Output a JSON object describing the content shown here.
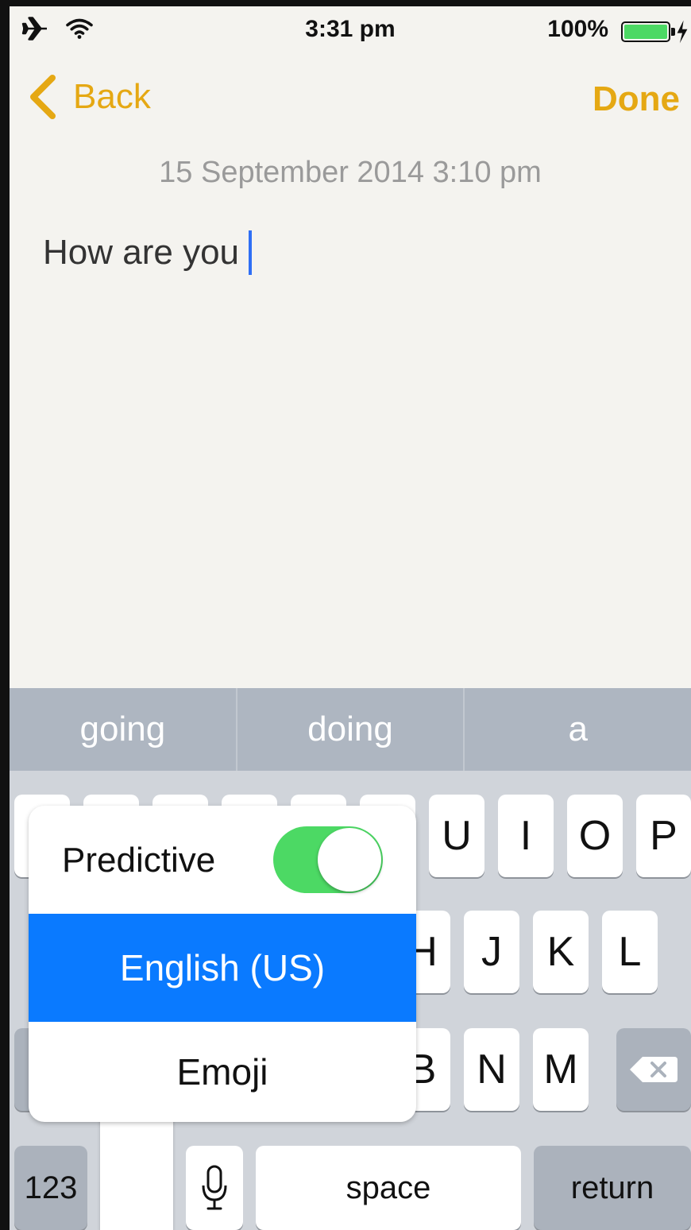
{
  "status_bar": {
    "time": "3:31 pm",
    "battery_percent": "100%",
    "battery_level": 1.0,
    "icons": [
      "airplane-icon",
      "wifi-icon",
      "battery-icon",
      "charging-bolt-icon"
    ]
  },
  "nav": {
    "back_label": "Back",
    "done_label": "Done",
    "accent_color": "#e5a813"
  },
  "note": {
    "date": "15 September 2014 3:10 pm",
    "text": "How are you"
  },
  "keyboard": {
    "predictions": [
      "going",
      "doing",
      "a"
    ],
    "row1": [
      "U",
      "I",
      "O",
      "P"
    ],
    "row2": [
      "H",
      "J",
      "K",
      "L"
    ],
    "row3": [
      "B",
      "N",
      "M"
    ],
    "numbers_key": "123",
    "space_key": "space",
    "return_key": "return"
  },
  "input_menu": {
    "predictive_label": "Predictive",
    "predictive_on": true,
    "selected_language": "English (US)",
    "emoji_label": "Emoji",
    "selected_color": "#0a7aff",
    "toggle_color": "#4cd964"
  }
}
